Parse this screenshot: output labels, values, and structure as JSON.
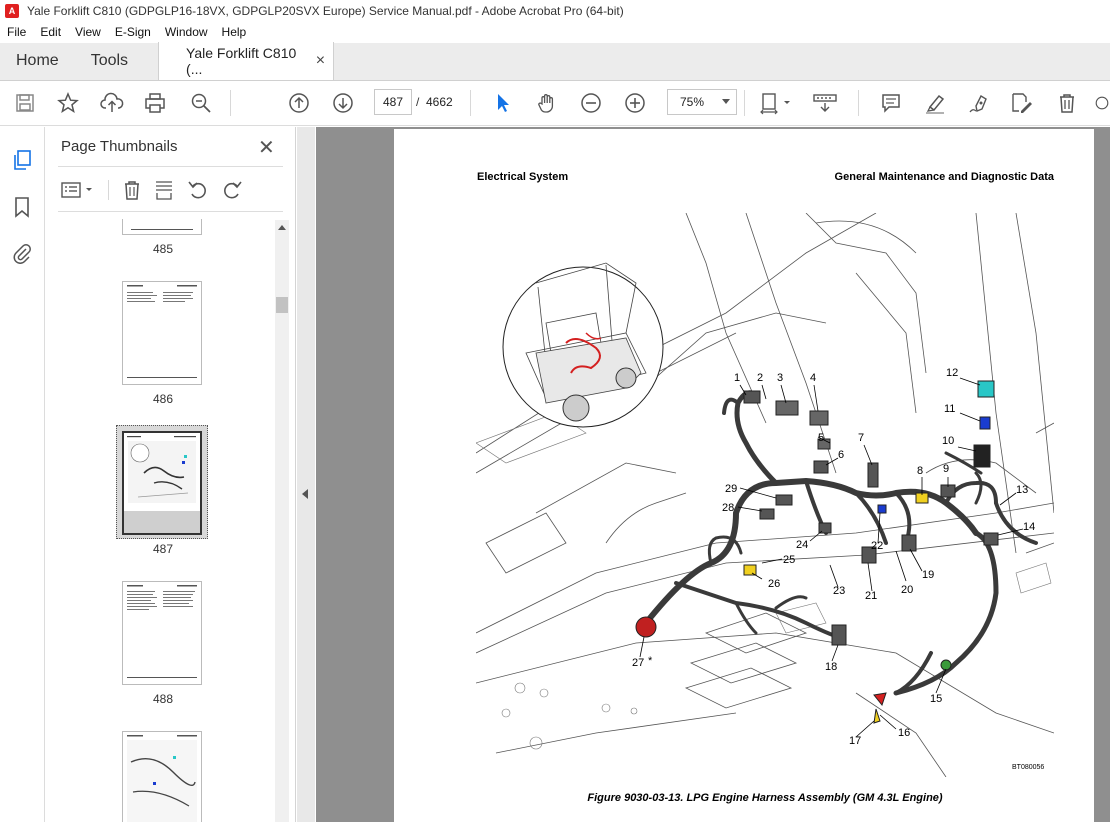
{
  "window": {
    "title": "Yale Forklift C810 (GDPGLP16-18VX, GDPGLP20SVX Europe) Service Manual.pdf - Adobe Acrobat Pro (64-bit)",
    "app_icon": "pdf-icon"
  },
  "menu": [
    "File",
    "Edit",
    "View",
    "E-Sign",
    "Window",
    "Help"
  ],
  "tabs": {
    "home": "Home",
    "tools": "Tools",
    "document": "Yale Forklift C810 (...",
    "close": "×"
  },
  "toolbar": {
    "current_page": "487",
    "page_separator": "/",
    "total_pages": "4662",
    "zoom": "75%"
  },
  "thumbnails_panel": {
    "title": "Page Thumbnails",
    "close": "✕",
    "pages": [
      {
        "label": "485",
        "selected": false
      },
      {
        "label": "486",
        "selected": false
      },
      {
        "label": "487",
        "selected": true
      },
      {
        "label": "488",
        "selected": false
      },
      {
        "label": "",
        "selected": false
      }
    ]
  },
  "page": {
    "header_left": "Electrical System",
    "header_right": "General Maintenance and Diagnostic Data",
    "figure_id": "BT080056",
    "caption": "Figure 9030-03-13. LPG Engine Harness Assembly (GM 4.3L Engine)",
    "callouts": [
      "1",
      "2",
      "3",
      "4",
      "5",
      "6",
      "7",
      "8",
      "9",
      "10",
      "11",
      "12",
      "13",
      "14",
      "15",
      "16",
      "17",
      "18",
      "19",
      "20",
      "21",
      "22",
      "23",
      "24",
      "25",
      "26",
      "27",
      "28",
      "29"
    ],
    "callout_27_suffix": "*"
  },
  "colors": {
    "accent_blue": "#1473e6",
    "harness_red": "#d42020",
    "connector_cyan": "#29c7c7",
    "connector_blue": "#1a3ccf",
    "connector_yellow": "#f0d020",
    "connector_green": "#3a9a3a"
  }
}
